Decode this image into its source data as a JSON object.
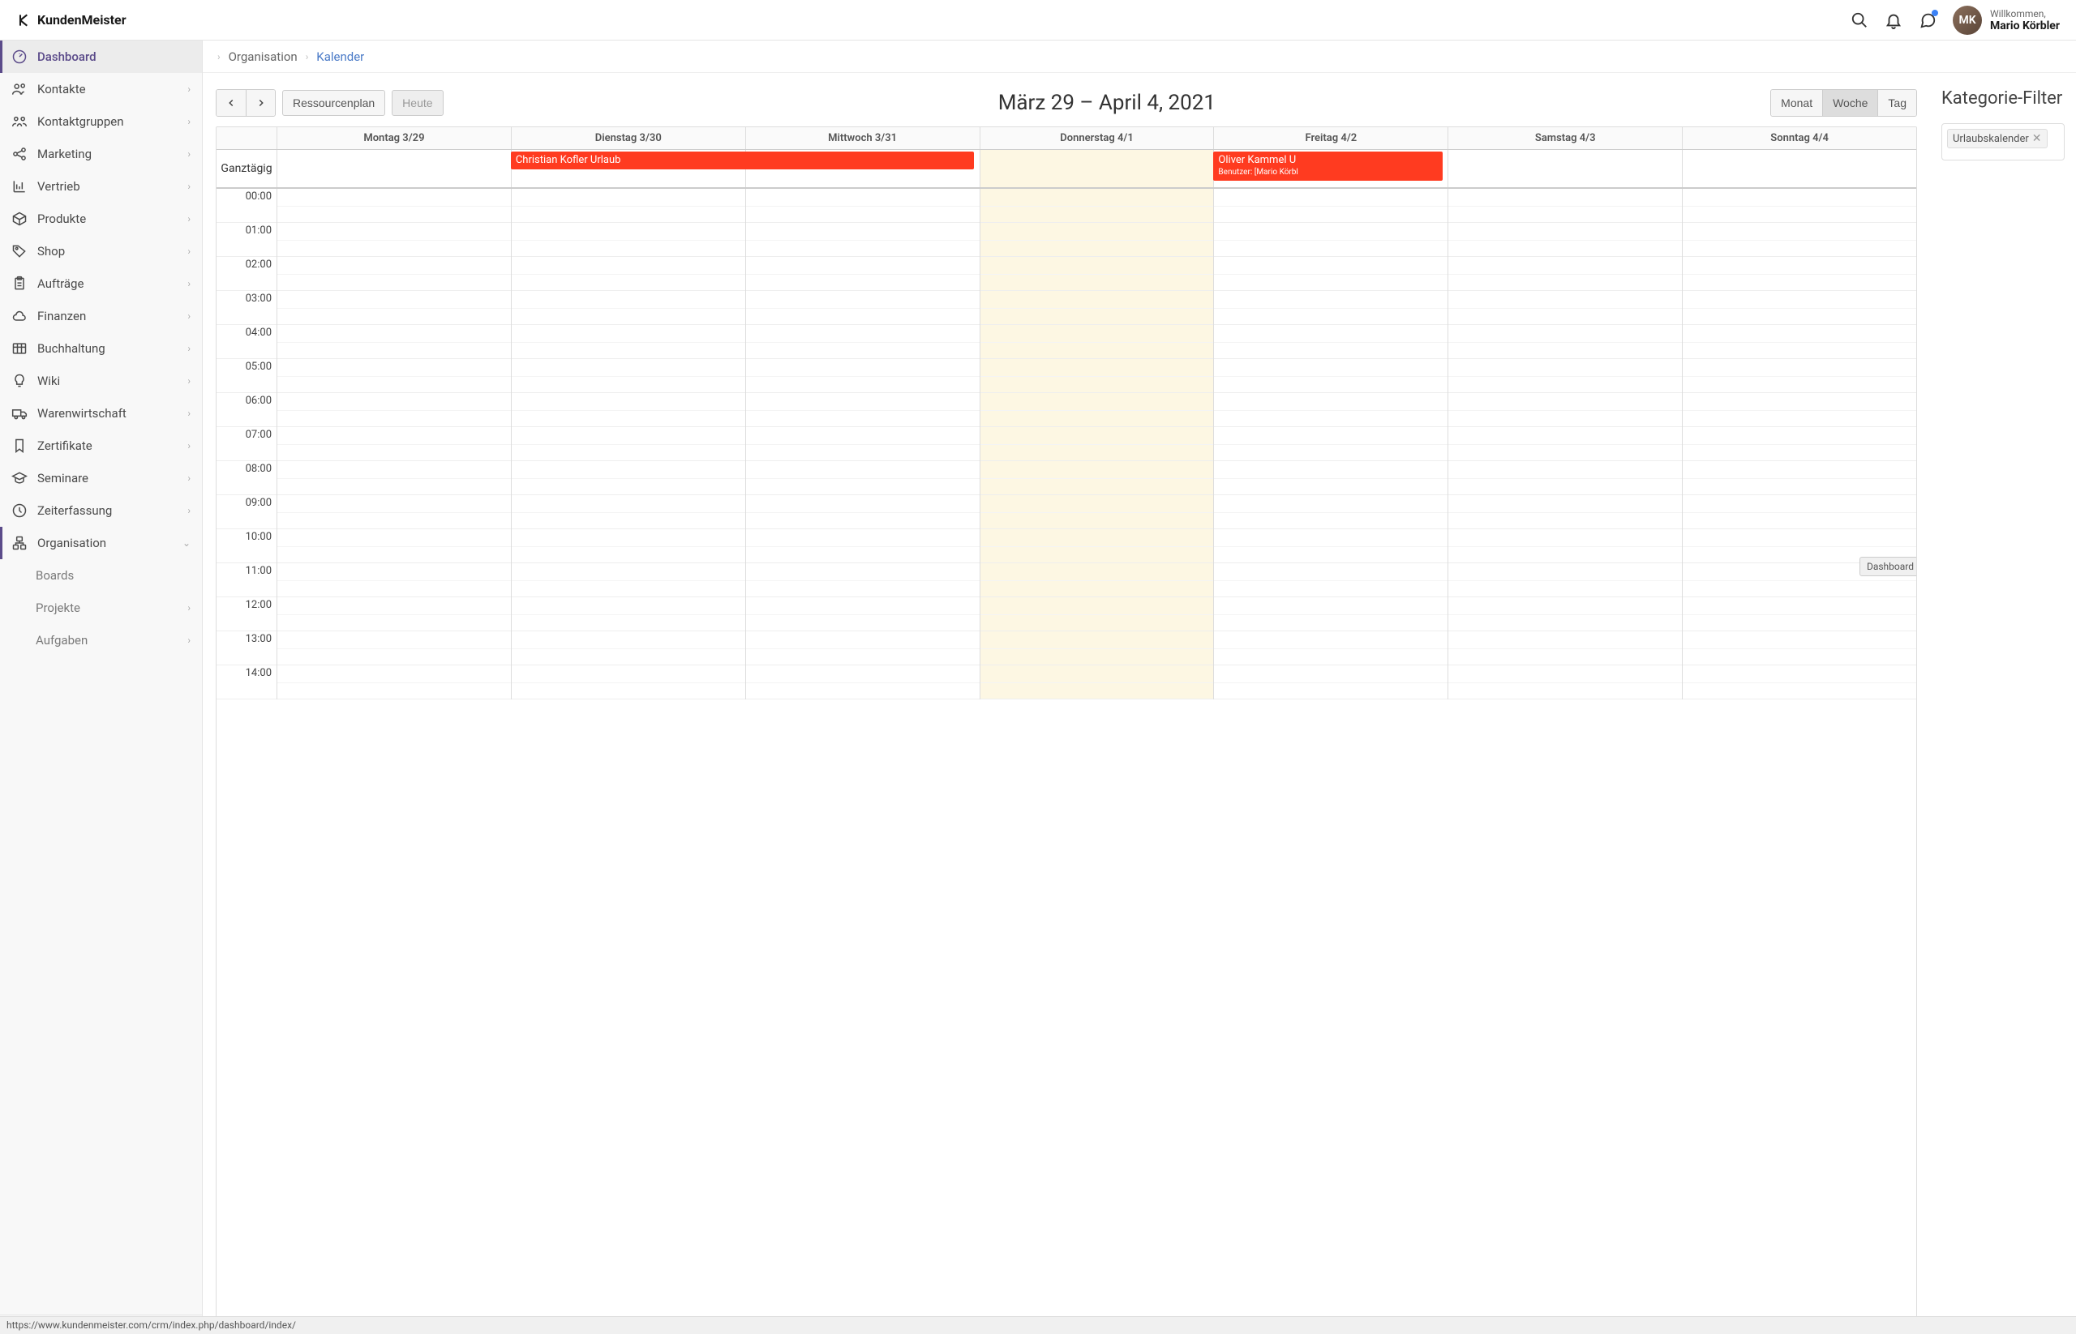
{
  "app_name": "KundenMeister",
  "header": {
    "welcome_label": "Willkommen,",
    "user_name": "Mario Körbler",
    "avatar_initials": "MK"
  },
  "sidebar": {
    "items": [
      {
        "label": "Dashboard",
        "expandable": false,
        "active": true,
        "icon": "gauge"
      },
      {
        "label": "Kontakte",
        "expandable": true,
        "icon": "users"
      },
      {
        "label": "Kontaktgruppen",
        "expandable": true,
        "icon": "group"
      },
      {
        "label": "Marketing",
        "expandable": true,
        "icon": "share"
      },
      {
        "label": "Vertrieb",
        "expandable": true,
        "icon": "chart"
      },
      {
        "label": "Produkte",
        "expandable": true,
        "icon": "box"
      },
      {
        "label": "Shop",
        "expandable": true,
        "icon": "tag"
      },
      {
        "label": "Aufträge",
        "expandable": true,
        "icon": "clipboard"
      },
      {
        "label": "Finanzen",
        "expandable": true,
        "icon": "cloud"
      },
      {
        "label": "Buchhaltung",
        "expandable": true,
        "icon": "table"
      },
      {
        "label": "Wiki",
        "expandable": true,
        "icon": "bulb"
      },
      {
        "label": "Warenwirtschaft",
        "expandable": true,
        "icon": "truck"
      },
      {
        "label": "Zertifikate",
        "expandable": true,
        "icon": "bookmark"
      },
      {
        "label": "Seminare",
        "expandable": true,
        "icon": "cap"
      },
      {
        "label": "Zeiterfassung",
        "expandable": true,
        "icon": "clock"
      },
      {
        "label": "Organisation",
        "expandable": true,
        "open": true,
        "icon": "org"
      }
    ],
    "org_subs": [
      {
        "label": "Boards",
        "expandable": false
      },
      {
        "label": "Projekte",
        "expandable": true
      },
      {
        "label": "Aufgaben",
        "expandable": true
      }
    ]
  },
  "breadcrumb": {
    "level1": "Organisation",
    "level2": "Kalender"
  },
  "calendar": {
    "toolbar": {
      "ressourcenplan": "Ressourcenplan",
      "heute": "Heute",
      "range_title": "März 29 – April 4, 2021",
      "monat": "Monat",
      "woche": "Woche",
      "tag": "Tag"
    },
    "days": [
      "Montag 3/29",
      "Dienstag 3/30",
      "Mittwoch 3/31",
      "Donnerstag 4/1",
      "Freitag 4/2",
      "Samstag 4/3",
      "Sonntag 4/4"
    ],
    "allday_label": "Ganztägig",
    "today_index": 3,
    "hours": [
      "00:00",
      "01:00",
      "02:00",
      "03:00",
      "04:00",
      "05:00",
      "06:00",
      "07:00",
      "08:00",
      "09:00",
      "10:00",
      "11:00",
      "12:00",
      "13:00",
      "14:00"
    ],
    "events": {
      "event1": {
        "title": "Christian Kofler Urlaub",
        "sub": ""
      },
      "event2": {
        "title": "Oliver Kammel U",
        "sub": "Benutzer: [Mario Körbl"
      }
    }
  },
  "filter": {
    "title": "Kategorie-Filter",
    "tag": "Urlaubskalender"
  },
  "tooltip": "Dashboard",
  "statusbar": "https://www.kundenmeister.com/crm/index.php/dashboard/index/"
}
